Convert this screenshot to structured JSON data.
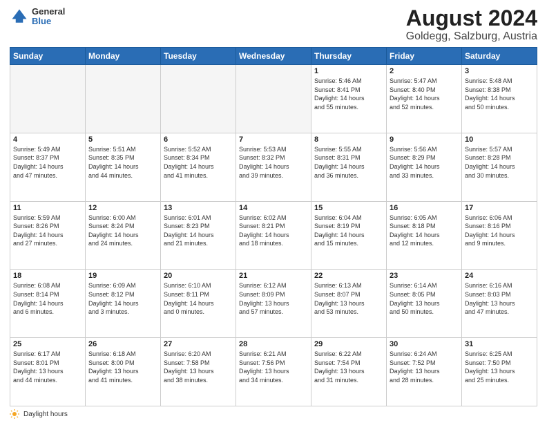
{
  "header": {
    "logo_general": "General",
    "logo_blue": "Blue",
    "title": "August 2024",
    "location": "Goldegg, Salzburg, Austria"
  },
  "calendar": {
    "days_of_week": [
      "Sunday",
      "Monday",
      "Tuesday",
      "Wednesday",
      "Thursday",
      "Friday",
      "Saturday"
    ],
    "weeks": [
      [
        {
          "day": "",
          "info": ""
        },
        {
          "day": "",
          "info": ""
        },
        {
          "day": "",
          "info": ""
        },
        {
          "day": "",
          "info": ""
        },
        {
          "day": "1",
          "info": "Sunrise: 5:46 AM\nSunset: 8:41 PM\nDaylight: 14 hours\nand 55 minutes."
        },
        {
          "day": "2",
          "info": "Sunrise: 5:47 AM\nSunset: 8:40 PM\nDaylight: 14 hours\nand 52 minutes."
        },
        {
          "day": "3",
          "info": "Sunrise: 5:48 AM\nSunset: 8:38 PM\nDaylight: 14 hours\nand 50 minutes."
        }
      ],
      [
        {
          "day": "4",
          "info": "Sunrise: 5:49 AM\nSunset: 8:37 PM\nDaylight: 14 hours\nand 47 minutes."
        },
        {
          "day": "5",
          "info": "Sunrise: 5:51 AM\nSunset: 8:35 PM\nDaylight: 14 hours\nand 44 minutes."
        },
        {
          "day": "6",
          "info": "Sunrise: 5:52 AM\nSunset: 8:34 PM\nDaylight: 14 hours\nand 41 minutes."
        },
        {
          "day": "7",
          "info": "Sunrise: 5:53 AM\nSunset: 8:32 PM\nDaylight: 14 hours\nand 39 minutes."
        },
        {
          "day": "8",
          "info": "Sunrise: 5:55 AM\nSunset: 8:31 PM\nDaylight: 14 hours\nand 36 minutes."
        },
        {
          "day": "9",
          "info": "Sunrise: 5:56 AM\nSunset: 8:29 PM\nDaylight: 14 hours\nand 33 minutes."
        },
        {
          "day": "10",
          "info": "Sunrise: 5:57 AM\nSunset: 8:28 PM\nDaylight: 14 hours\nand 30 minutes."
        }
      ],
      [
        {
          "day": "11",
          "info": "Sunrise: 5:59 AM\nSunset: 8:26 PM\nDaylight: 14 hours\nand 27 minutes."
        },
        {
          "day": "12",
          "info": "Sunrise: 6:00 AM\nSunset: 8:24 PM\nDaylight: 14 hours\nand 24 minutes."
        },
        {
          "day": "13",
          "info": "Sunrise: 6:01 AM\nSunset: 8:23 PM\nDaylight: 14 hours\nand 21 minutes."
        },
        {
          "day": "14",
          "info": "Sunrise: 6:02 AM\nSunset: 8:21 PM\nDaylight: 14 hours\nand 18 minutes."
        },
        {
          "day": "15",
          "info": "Sunrise: 6:04 AM\nSunset: 8:19 PM\nDaylight: 14 hours\nand 15 minutes."
        },
        {
          "day": "16",
          "info": "Sunrise: 6:05 AM\nSunset: 8:18 PM\nDaylight: 14 hours\nand 12 minutes."
        },
        {
          "day": "17",
          "info": "Sunrise: 6:06 AM\nSunset: 8:16 PM\nDaylight: 14 hours\nand 9 minutes."
        }
      ],
      [
        {
          "day": "18",
          "info": "Sunrise: 6:08 AM\nSunset: 8:14 PM\nDaylight: 14 hours\nand 6 minutes."
        },
        {
          "day": "19",
          "info": "Sunrise: 6:09 AM\nSunset: 8:12 PM\nDaylight: 14 hours\nand 3 minutes."
        },
        {
          "day": "20",
          "info": "Sunrise: 6:10 AM\nSunset: 8:11 PM\nDaylight: 14 hours\nand 0 minutes."
        },
        {
          "day": "21",
          "info": "Sunrise: 6:12 AM\nSunset: 8:09 PM\nDaylight: 13 hours\nand 57 minutes."
        },
        {
          "day": "22",
          "info": "Sunrise: 6:13 AM\nSunset: 8:07 PM\nDaylight: 13 hours\nand 53 minutes."
        },
        {
          "day": "23",
          "info": "Sunrise: 6:14 AM\nSunset: 8:05 PM\nDaylight: 13 hours\nand 50 minutes."
        },
        {
          "day": "24",
          "info": "Sunrise: 6:16 AM\nSunset: 8:03 PM\nDaylight: 13 hours\nand 47 minutes."
        }
      ],
      [
        {
          "day": "25",
          "info": "Sunrise: 6:17 AM\nSunset: 8:01 PM\nDaylight: 13 hours\nand 44 minutes."
        },
        {
          "day": "26",
          "info": "Sunrise: 6:18 AM\nSunset: 8:00 PM\nDaylight: 13 hours\nand 41 minutes."
        },
        {
          "day": "27",
          "info": "Sunrise: 6:20 AM\nSunset: 7:58 PM\nDaylight: 13 hours\nand 38 minutes."
        },
        {
          "day": "28",
          "info": "Sunrise: 6:21 AM\nSunset: 7:56 PM\nDaylight: 13 hours\nand 34 minutes."
        },
        {
          "day": "29",
          "info": "Sunrise: 6:22 AM\nSunset: 7:54 PM\nDaylight: 13 hours\nand 31 minutes."
        },
        {
          "day": "30",
          "info": "Sunrise: 6:24 AM\nSunset: 7:52 PM\nDaylight: 13 hours\nand 28 minutes."
        },
        {
          "day": "31",
          "info": "Sunrise: 6:25 AM\nSunset: 7:50 PM\nDaylight: 13 hours\nand 25 minutes."
        }
      ]
    ]
  },
  "footer": {
    "daylight_label": "Daylight hours"
  }
}
